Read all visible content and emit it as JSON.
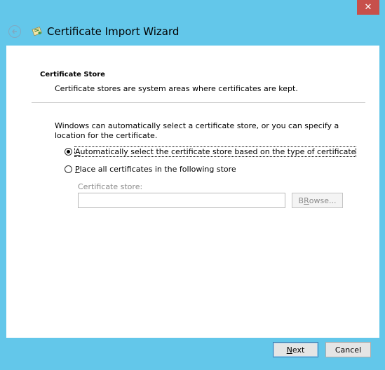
{
  "window": {
    "close_label": "✕",
    "title": "Certificate Import Wizard"
  },
  "page": {
    "heading": "Certificate Store",
    "description": "Certificate stores are system areas where certificates are kept.",
    "intro": "Windows can automatically select a certificate store, or you can specify a location for the certificate."
  },
  "options": {
    "auto": {
      "mnemonic": "A",
      "label_rest": "utomatically select the certificate store based on the type of certificate",
      "selected": true
    },
    "manual": {
      "mnemonic": "P",
      "label_rest": "lace all certificates in the following store",
      "selected": false
    }
  },
  "store": {
    "label": "Certificate store:",
    "value": "",
    "browse_mnemonic": "R",
    "browse_pre": "B",
    "browse_post": "owse..."
  },
  "footer": {
    "next_mnemonic": "N",
    "next_rest": "ext",
    "cancel_label": "Cancel"
  },
  "colors": {
    "frame": "#63c7ea",
    "close": "#c7504b"
  }
}
